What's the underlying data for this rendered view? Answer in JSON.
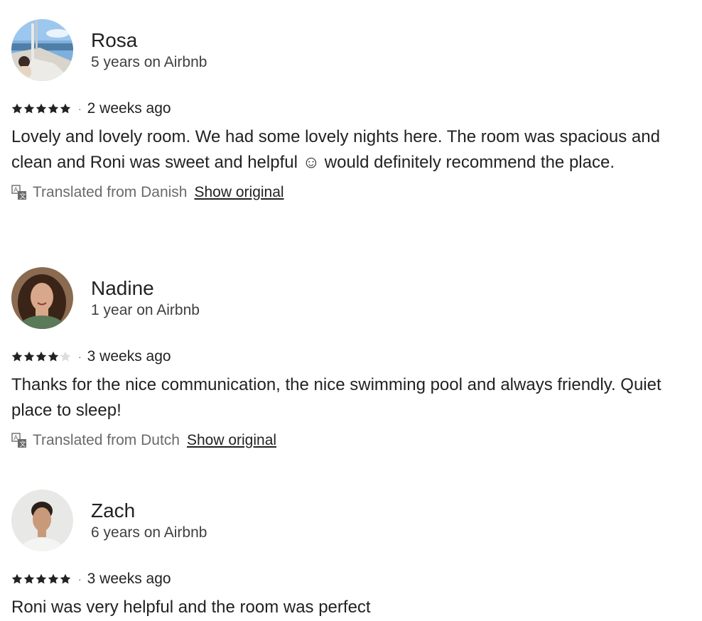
{
  "colors": {
    "text_primary": "#222222",
    "text_secondary": "#6a6a6a",
    "star_filled": "#222222",
    "star_empty": "#dddddd"
  },
  "reviews": [
    {
      "name": "Rosa",
      "tenure": "5 years on Airbnb",
      "rating": 5,
      "max_rating": 5,
      "separator": "·",
      "time_ago": "2 weeks ago",
      "body": "Lovely and lovely room. We had some lovely nights here. The room was spacious and clean and Roni was sweet and helpful ☺ would definitely recommend the place.",
      "translation_note": "Translated from Danish",
      "show_original_label": "Show original",
      "avatar_icon": "avatar-photo-boat"
    },
    {
      "name": "Nadine",
      "tenure": "1 year on Airbnb",
      "rating": 4,
      "max_rating": 5,
      "separator": "·",
      "time_ago": "3 weeks ago",
      "body": "Thanks for the nice communication, the nice swimming pool and always friendly. Quiet place to sleep!",
      "translation_note": "Translated from Dutch",
      "show_original_label": "Show original",
      "avatar_icon": "avatar-photo-woman"
    },
    {
      "name": "Zach",
      "tenure": "6 years on Airbnb",
      "rating": 5,
      "max_rating": 5,
      "separator": "·",
      "time_ago": "3 weeks ago",
      "body": "Roni was very helpful and the room was perfect",
      "avatar_icon": "avatar-photo-man"
    }
  ]
}
